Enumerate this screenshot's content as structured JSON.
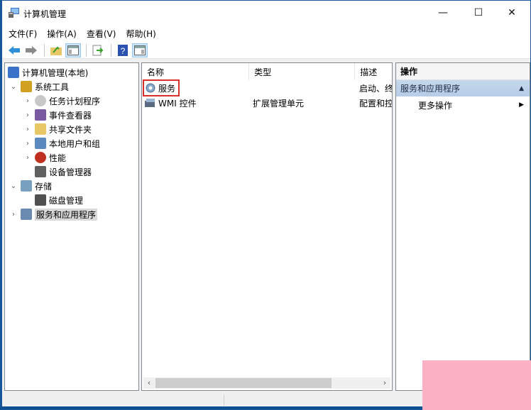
{
  "window": {
    "title": "计算机管理",
    "controls": {
      "minimize": "—",
      "maximize": "☐",
      "close": "✕"
    }
  },
  "menubar": [
    "文件(F)",
    "操作(A)",
    "查看(V)",
    "帮助(H)"
  ],
  "toolbar": {
    "buttons": [
      "back-arrow",
      "forward-arrow",
      "up-folder",
      "show-hide-console-tree",
      "export-list",
      "help",
      "show-hide-action-pane"
    ]
  },
  "tree": {
    "items": [
      {
        "label": "计算机管理(本地)",
        "level": 0,
        "expander": "",
        "icon": "computer-management-icon"
      },
      {
        "label": "系统工具",
        "level": 1,
        "expander": "⌄",
        "icon": "tools-icon"
      },
      {
        "label": "任务计划程序",
        "level": 2,
        "expander": "›",
        "icon": "clock-icon"
      },
      {
        "label": "事件查看器",
        "level": 2,
        "expander": "›",
        "icon": "event-viewer-icon"
      },
      {
        "label": "共享文件夹",
        "level": 2,
        "expander": "›",
        "icon": "shared-folder-icon"
      },
      {
        "label": "本地用户和组",
        "level": 2,
        "expander": "›",
        "icon": "users-icon"
      },
      {
        "label": "性能",
        "level": 2,
        "expander": "›",
        "icon": "performance-icon"
      },
      {
        "label": "设备管理器",
        "level": 2,
        "expander": "",
        "icon": "device-manager-icon"
      },
      {
        "label": "存储",
        "level": 1,
        "expander": "⌄",
        "icon": "storage-icon"
      },
      {
        "label": "磁盘管理",
        "level": 2,
        "expander": "",
        "icon": "disk-icon"
      },
      {
        "label": "服务和应用程序",
        "level": 1,
        "expander": "›",
        "icon": "services-apps-icon",
        "selected": true
      }
    ]
  },
  "list": {
    "columns": [
      "名称",
      "类型",
      "描述"
    ],
    "rows": [
      {
        "name": "服务",
        "type": "",
        "desc": "启动、终",
        "icon": "gear-icon",
        "highlighted": true
      },
      {
        "name": "WMI 控件",
        "type": "扩展管理单元",
        "desc": "配置和控",
        "icon": "wmi-icon"
      }
    ],
    "scroll": {
      "left_arrow": "‹",
      "right_arrow": "›",
      "thumb_fraction": 0.75
    }
  },
  "actions": {
    "header": "操作",
    "section": "服务和应用程序",
    "section_caret": "▲",
    "items": [
      {
        "label": "更多操作",
        "caret": "▶"
      }
    ]
  },
  "colors": {
    "title_border": "#1a5aa0",
    "highlight_box": "#d9302a",
    "action_section_bg": "#c5d8ec",
    "watermark": "#fcb0c4"
  }
}
